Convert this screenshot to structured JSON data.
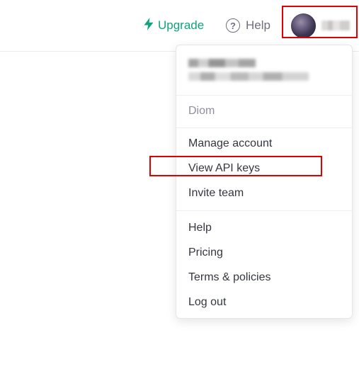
{
  "header": {
    "upgrade_label": "Upgrade",
    "help_label": "Help",
    "help_icon_glyph": "?",
    "accent_color": "#10a37f"
  },
  "menu": {
    "organization": "Diom",
    "account_items": [
      "Manage account",
      "View API keys",
      "Invite team"
    ],
    "support_items": [
      "Help",
      "Pricing",
      "Terms & policies",
      "Log out"
    ]
  },
  "annotations": {
    "highlight_color": "#e00000"
  }
}
